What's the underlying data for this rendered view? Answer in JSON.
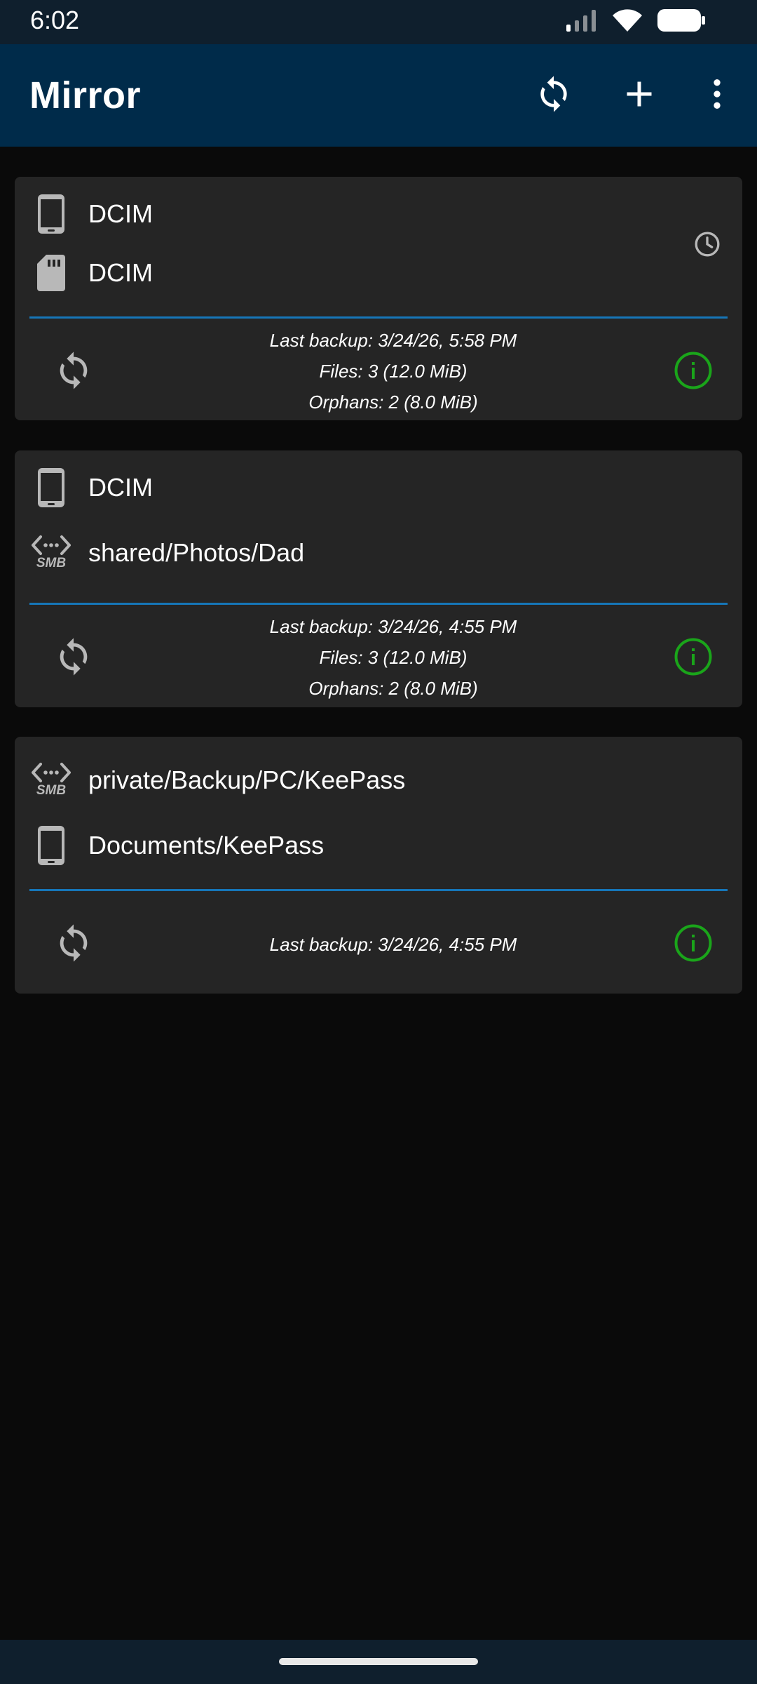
{
  "status_bar": {
    "time": "6:02"
  },
  "app_bar": {
    "title": "Mirror",
    "actions": [
      "sync-all-icon",
      "add-icon",
      "more-vert-icon"
    ]
  },
  "colors": {
    "app_bar": "#002b4a",
    "status_bar": "#0f1f2d",
    "card": "#252525",
    "divider": "#1676b8",
    "info_ok": "#1aa51a",
    "icon_gray": "#b8b8b8"
  },
  "cards": [
    {
      "source": {
        "icon": "phone-icon",
        "label": "DCIM"
      },
      "destination": {
        "icon": "sd-card-icon",
        "label": "DCIM"
      },
      "scheduled": true,
      "last_backup": "Last backup: 3/24/26, 5:58 PM",
      "files": "Files: 3 (12.0 MiB)",
      "orphans": "Orphans: 2 (8.0 MiB)"
    },
    {
      "source": {
        "icon": "phone-icon",
        "label": "DCIM"
      },
      "destination": {
        "icon": "smb-icon",
        "icon_text": "SMB",
        "label": "shared/Photos/Dad"
      },
      "scheduled": false,
      "last_backup": "Last backup: 3/24/26, 4:55 PM",
      "files": "Files: 3 (12.0 MiB)",
      "orphans": "Orphans: 2 (8.0 MiB)"
    },
    {
      "source": {
        "icon": "smb-icon",
        "icon_text": "SMB",
        "label": "private/Backup/PC/KeePass"
      },
      "destination": {
        "icon": "phone-icon",
        "label": "Documents/KeePass"
      },
      "scheduled": false,
      "last_backup": "Last backup: 3/24/26, 4:55 PM"
    }
  ]
}
